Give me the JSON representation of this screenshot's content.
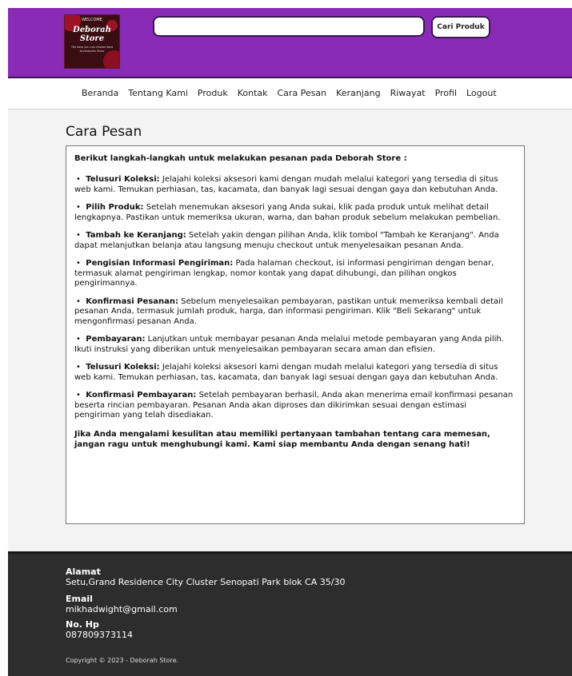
{
  "header": {
    "logo": {
      "top_text": "WELCOME",
      "name": "Deborah Store",
      "tagline": "The best you can choose best Accessories Store"
    },
    "search": {
      "placeholder": "",
      "button_label": "Cari Produk"
    },
    "colors": {
      "bar": "#8a2bb7",
      "border": "#3a1750"
    }
  },
  "nav": {
    "items": [
      "Beranda",
      "Tentang Kami",
      "Produk",
      "Kontak",
      "Cara Pesan",
      "Keranjang",
      "Riwayat",
      "Profil",
      "Logout"
    ]
  },
  "main": {
    "title": "Cara Pesan",
    "intro": "Berikut langkah-langkah untuk melakukan pesanan pada Deborah Store :",
    "steps": [
      {
        "label": "Telusuri Koleksi:",
        "text": " Jelajahi koleksi aksesori kami dengan mudah melalui kategori yang tersedia di situs web kami. Temukan perhiasan, tas, kacamata, dan banyak lagi sesuai dengan gaya dan kebutuhan Anda."
      },
      {
        "label": "Pilih Produk:",
        "text": " Setelah menemukan aksesori yang Anda sukai, klik pada produk untuk melihat detail lengkapnya. Pastikan untuk memeriksa ukuran, warna, dan bahan produk sebelum melakukan pembelian."
      },
      {
        "label": "Tambah ke Keranjang:",
        "text": " Setelah yakin dengan pilihan Anda, klik tombol \"Tambah ke Keranjang\". Anda dapat melanjutkan belanja atau langsung menuju checkout untuk menyelesaikan pesanan Anda."
      },
      {
        "label": "Pengisian Informasi Pengiriman:",
        "text": " Pada halaman checkout, isi informasi pengiriman dengan benar, termasuk alamat pengiriman lengkap, nomor kontak yang dapat dihubungi, dan pilihan ongkos pengirimannya."
      },
      {
        "label": "Konfirmasi Pesanan:",
        "text": " Sebelum menyelesaikan pembayaran, pastikan untuk memeriksa kembali detail pesanan Anda, termasuk jumlah produk, harga, dan informasi pengiriman. Klik \"Beli Sekarang\" untuk mengonfirmasi pesanan Anda."
      },
      {
        "label": "Pembayaran:",
        "text": " Lanjutkan untuk membayar pesanan Anda melalui metode pembayaran yang Anda pilih. Ikuti instruksi yang diberikan untuk menyelesaikan pembayaran secara aman dan efisien."
      },
      {
        "label": "Telusuri Koleksi:",
        "text": " Jelajahi koleksi aksesori kami dengan mudah melalui kategori yang tersedia di situs web kami. Temukan perhiasan, tas, kacamata, dan banyak lagi sesuai dengan gaya dan kebutuhan Anda."
      },
      {
        "label": "Konfirmasi Pembayaran:",
        "text": " Setelah pembayaran berhasil, Anda akan menerima email konfirmasi pesanan beserta rincian pembayaran. Pesanan Anda akan diproses dan dikirimkan sesuai dengan estimasi pengiriman yang telah disediakan."
      }
    ],
    "closing": "Jika Anda mengalami kesulitan atau memiliki pertanyaan tambahan tentang cara memesan, jangan ragu untuk menghubungi kami. Kami siap membantu Anda dengan senang hati!"
  },
  "footer": {
    "address_label": "Alamat",
    "address": "Setu,Grand Residence City Cluster Senopati Park blok CA 35/30",
    "email_label": "Email",
    "email": "mikhadwight@gmail.com",
    "phone_label": "No. Hp",
    "phone": "087809373114",
    "copyright": "Copyright © 2023 - Deborah Store."
  }
}
